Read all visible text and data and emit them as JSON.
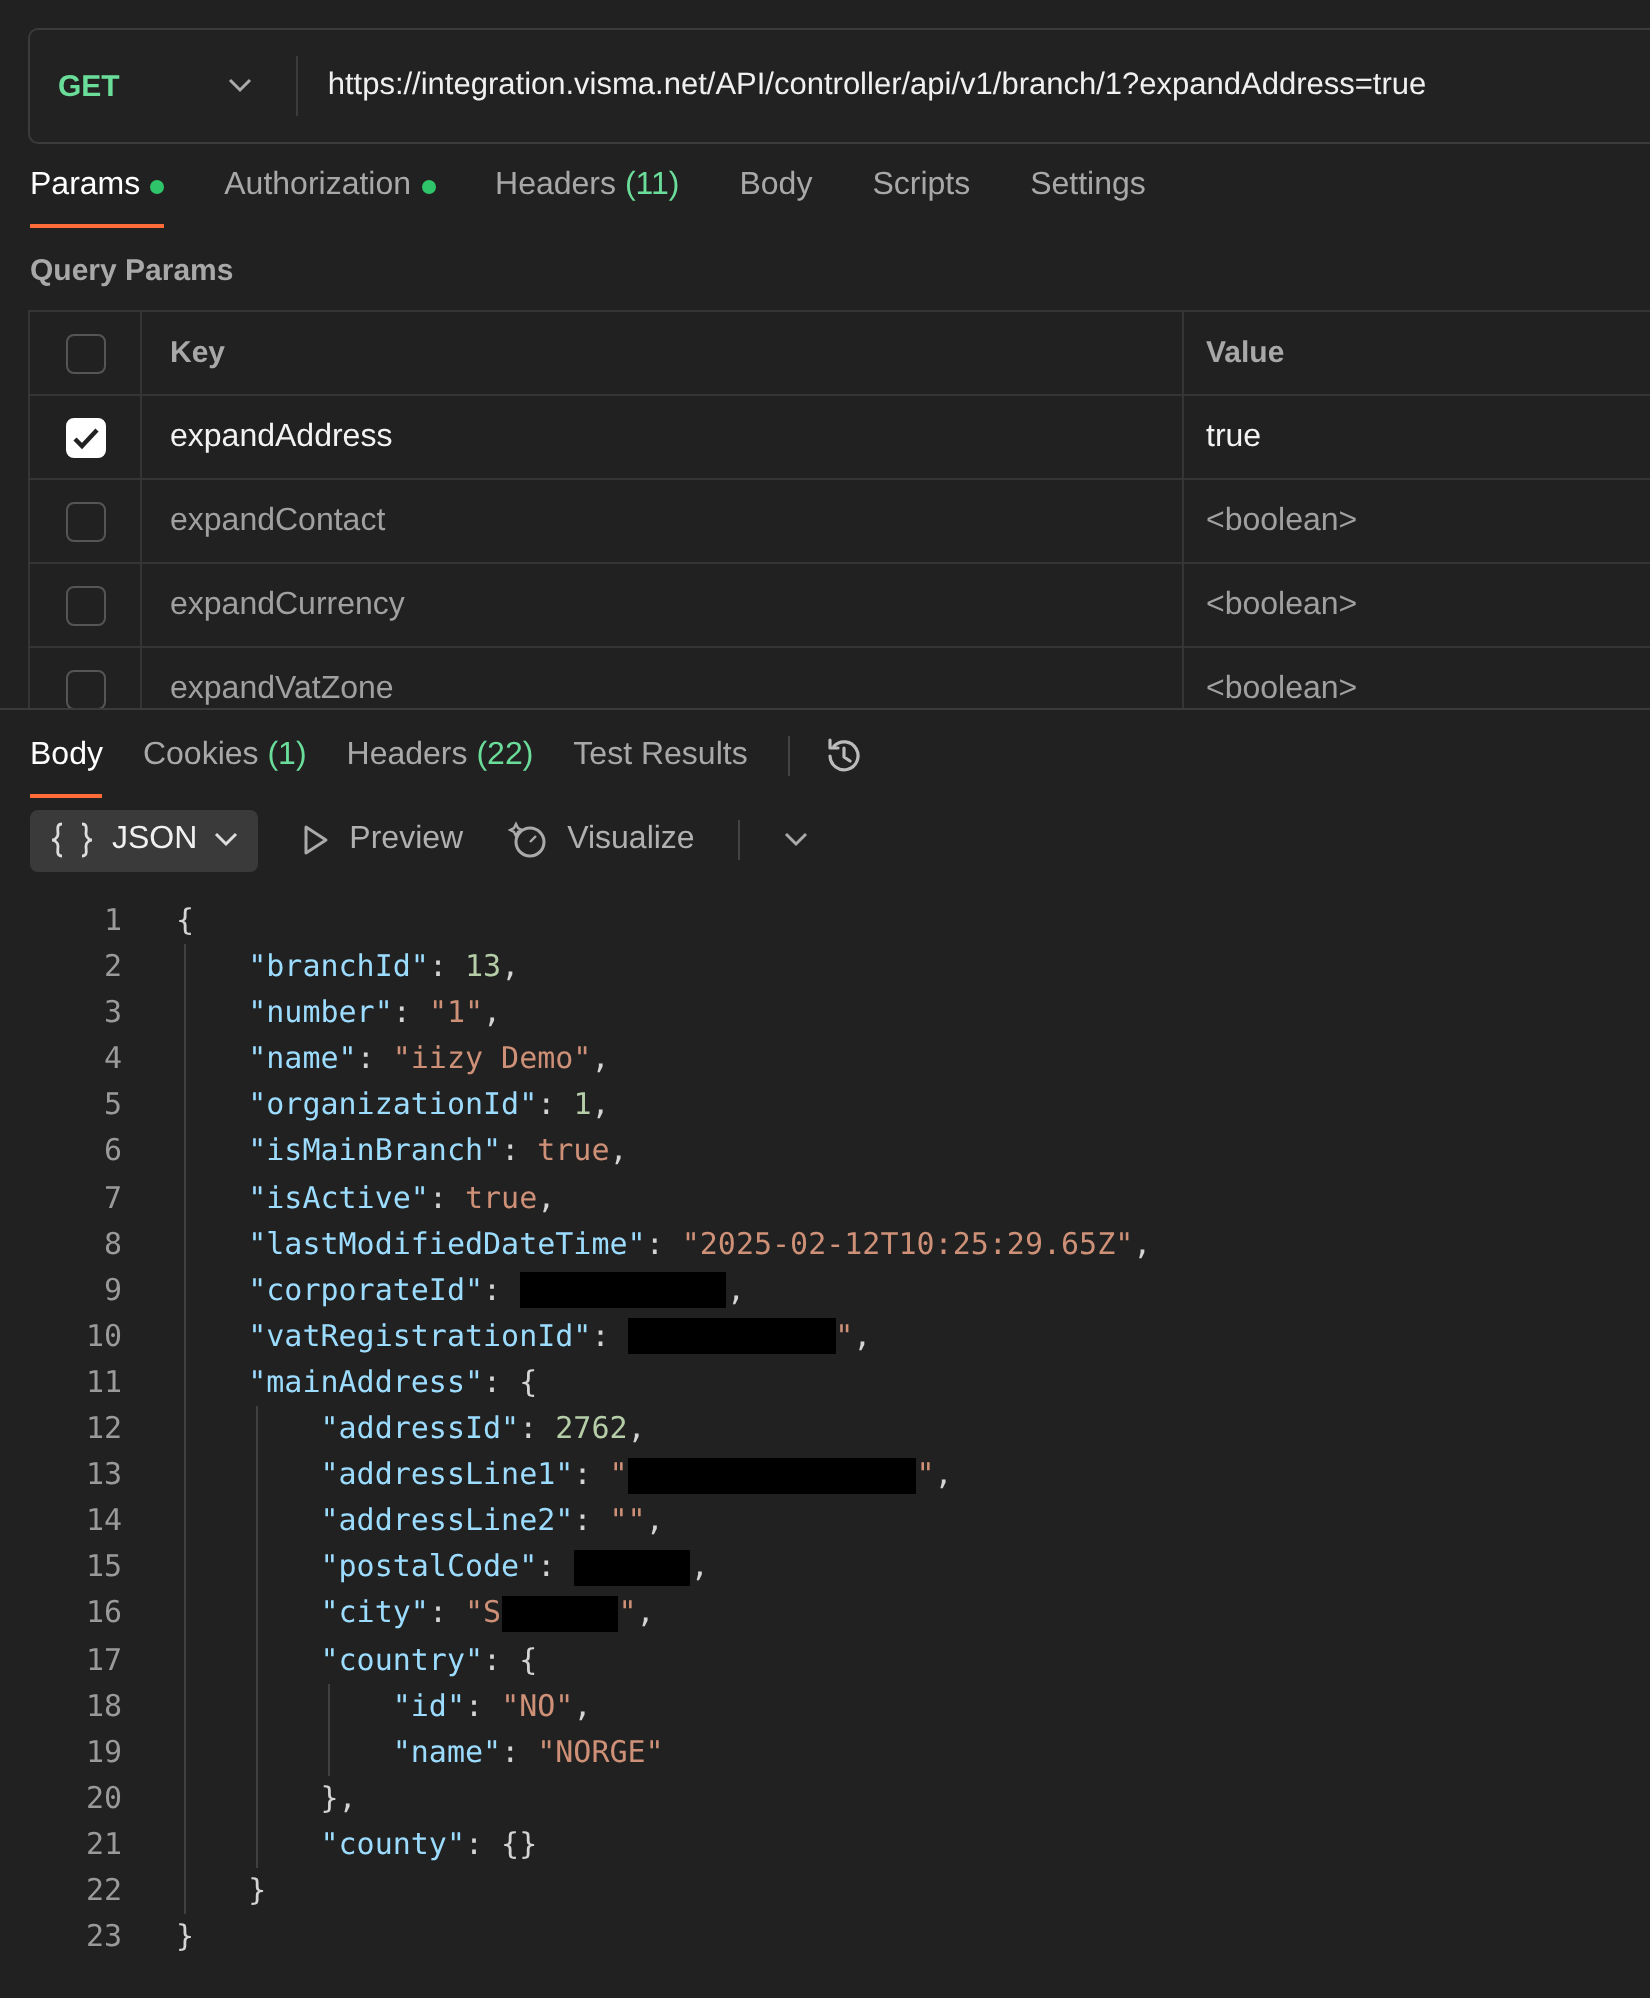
{
  "request": {
    "method": "GET",
    "url": "https://integration.visma.net/API/controller/api/v1/branch/1?expandAddress=true"
  },
  "request_tabs": [
    {
      "label": "Params",
      "dot": true,
      "selected": true
    },
    {
      "label": "Authorization",
      "dot": true,
      "selected": false
    },
    {
      "label": "Headers",
      "count": "(11)",
      "dot": false,
      "selected": false
    },
    {
      "label": "Body",
      "dot": false,
      "selected": false
    },
    {
      "label": "Scripts",
      "dot": false,
      "selected": false
    },
    {
      "label": "Settings",
      "dot": false,
      "selected": false
    }
  ],
  "query_params": {
    "title": "Query Params",
    "columns": [
      "Key",
      "Value"
    ],
    "header_checked": false,
    "rows": [
      {
        "key": "expandAddress",
        "value": "true",
        "checked": true
      },
      {
        "key": "expandContact",
        "value": "<boolean>",
        "checked": false
      },
      {
        "key": "expandCurrency",
        "value": "<boolean>",
        "checked": false
      },
      {
        "key": "expandVatZone",
        "value": "<boolean>",
        "checked": false
      }
    ]
  },
  "response_tabs": [
    {
      "label": "Body",
      "selected": true
    },
    {
      "label": "Cookies",
      "count": "(1)",
      "selected": false
    },
    {
      "label": "Headers",
      "count": "(22)",
      "selected": false
    },
    {
      "label": "Test Results",
      "selected": false
    }
  ],
  "response_toolbar": {
    "format": "JSON",
    "preview": "Preview",
    "visualize": "Visualize"
  },
  "code_lines": [
    {
      "number": "1",
      "tokens": [
        {
          "kind": "punct",
          "text": "{"
        }
      ]
    },
    {
      "number": "2",
      "tokens": [
        {
          "kind": "key",
          "text": "    \"branchId\""
        },
        {
          "kind": "punct",
          "text": ": "
        },
        {
          "kind": "number",
          "text": "13"
        },
        {
          "kind": "punct",
          "text": ","
        }
      ]
    },
    {
      "number": "3",
      "tokens": [
        {
          "kind": "key",
          "text": "    \"number\""
        },
        {
          "kind": "punct",
          "text": ": "
        },
        {
          "kind": "string",
          "text": "\"1\""
        },
        {
          "kind": "punct",
          "text": ","
        }
      ]
    },
    {
      "number": "4",
      "tokens": [
        {
          "kind": "key",
          "text": "    \"name\""
        },
        {
          "kind": "punct",
          "text": ": "
        },
        {
          "kind": "string",
          "text": "\"iizy Demo\""
        },
        {
          "kind": "punct",
          "text": ","
        }
      ]
    },
    {
      "number": "5",
      "tokens": [
        {
          "kind": "key",
          "text": "    \"organizationId\""
        },
        {
          "kind": "punct",
          "text": ": "
        },
        {
          "kind": "number",
          "text": "1"
        },
        {
          "kind": "punct",
          "text": ","
        }
      ]
    },
    {
      "number": "6",
      "tokens": [
        {
          "kind": "key",
          "text": "    \"isMainBranch\""
        },
        {
          "kind": "punct",
          "text": ": "
        },
        {
          "kind": "bool",
          "text": "true"
        },
        {
          "kind": "punct",
          "text": ","
        }
      ]
    },
    {
      "number": "7",
      "tokens": [
        {
          "kind": "key",
          "text": "    \"isActive\""
        },
        {
          "kind": "punct",
          "text": ": "
        },
        {
          "kind": "bool",
          "text": "true"
        },
        {
          "kind": "punct",
          "text": ","
        }
      ]
    },
    {
      "number": "8",
      "tokens": [
        {
          "kind": "key",
          "text": "    \"lastModifiedDateTime\""
        },
        {
          "kind": "punct",
          "text": ": "
        },
        {
          "kind": "string",
          "text": "\"2025-02-12T10:25:29.65Z\""
        },
        {
          "kind": "punct",
          "text": ","
        }
      ]
    },
    {
      "number": "9",
      "tokens": [
        {
          "kind": "key",
          "text": "    \"corporateId\""
        },
        {
          "kind": "punct",
          "text": ": "
        },
        {
          "kind": "redaction_medium"
        },
        {
          "kind": "punct",
          "text": ","
        }
      ]
    },
    {
      "number": "10",
      "tokens": [
        {
          "kind": "key",
          "text": "    \"vatRegistrationId\""
        },
        {
          "kind": "punct",
          "text": ": "
        },
        {
          "kind": "redaction_medium"
        },
        {
          "kind": "string",
          "text": "\""
        },
        {
          "kind": "punct",
          "text": ","
        }
      ]
    },
    {
      "number": "11",
      "tokens": [
        {
          "kind": "key",
          "text": "    \"mainAddress\""
        },
        {
          "kind": "punct",
          "text": ": {"
        }
      ]
    },
    {
      "number": "12",
      "tokens": [
        {
          "kind": "key",
          "text": "        \"addressId\""
        },
        {
          "kind": "punct",
          "text": ": "
        },
        {
          "kind": "number",
          "text": "2762"
        },
        {
          "kind": "punct",
          "text": ","
        }
      ]
    },
    {
      "number": "13",
      "tokens": [
        {
          "kind": "key",
          "text": "        \"addressLine1\""
        },
        {
          "kind": "punct",
          "text": ": "
        },
        {
          "kind": "string",
          "text": "\""
        },
        {
          "kind": "redaction_long"
        },
        {
          "kind": "string",
          "text": "\""
        },
        {
          "kind": "punct",
          "text": ","
        }
      ]
    },
    {
      "number": "14",
      "tokens": [
        {
          "kind": "key",
          "text": "        \"addressLine2\""
        },
        {
          "kind": "punct",
          "text": ": "
        },
        {
          "kind": "string",
          "text": "\"\""
        },
        {
          "kind": "punct",
          "text": ","
        }
      ]
    },
    {
      "number": "15",
      "tokens": [
        {
          "kind": "key",
          "text": "        \"postalCode\""
        },
        {
          "kind": "punct",
          "text": ": "
        },
        {
          "kind": "redaction_short"
        },
        {
          "kind": "punct",
          "text": ","
        }
      ]
    },
    {
      "number": "16",
      "tokens": [
        {
          "kind": "key",
          "text": "        \"city\""
        },
        {
          "kind": "punct",
          "text": ": "
        },
        {
          "kind": "string",
          "text": "\"S"
        },
        {
          "kind": "redaction_short"
        },
        {
          "kind": "string",
          "text": "\""
        },
        {
          "kind": "punct",
          "text": ","
        }
      ]
    },
    {
      "number": "17",
      "tokens": [
        {
          "kind": "key",
          "text": "        \"country\""
        },
        {
          "kind": "punct",
          "text": ": {"
        }
      ]
    },
    {
      "number": "18",
      "tokens": [
        {
          "kind": "key",
          "text": "            \"id\""
        },
        {
          "kind": "punct",
          "text": ": "
        },
        {
          "kind": "string",
          "text": "\"NO\""
        },
        {
          "kind": "punct",
          "text": ","
        }
      ]
    },
    {
      "number": "19",
      "tokens": [
        {
          "kind": "key",
          "text": "            \"name\""
        },
        {
          "kind": "punct",
          "text": ": "
        },
        {
          "kind": "string",
          "text": "\"NORGE\""
        }
      ]
    },
    {
      "number": "20",
      "tokens": [
        {
          "kind": "punct",
          "text": "        },"
        }
      ]
    },
    {
      "number": "21",
      "tokens": [
        {
          "kind": "key",
          "text": "        \"county\""
        },
        {
          "kind": "punct",
          "text": ": {}"
        }
      ]
    },
    {
      "number": "22",
      "tokens": [
        {
          "kind": "punct",
          "text": "    }"
        }
      ]
    },
    {
      "number": "23",
      "tokens": [
        {
          "kind": "punct",
          "text": "}"
        }
      ]
    }
  ]
}
